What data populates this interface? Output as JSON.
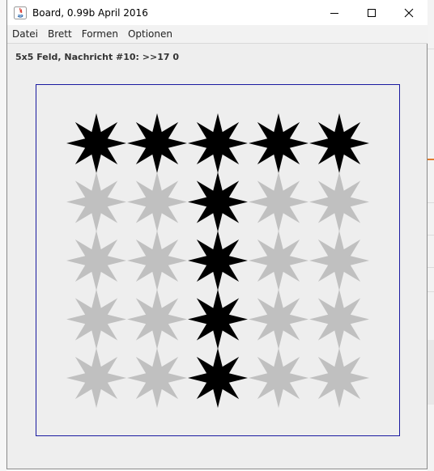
{
  "window": {
    "title": "Board, 0.99b April 2016",
    "controls": [
      "minimize-icon",
      "maximize-icon",
      "close-icon"
    ]
  },
  "menu": {
    "items": [
      "Datei",
      "Brett",
      "Formen",
      "Optionen"
    ]
  },
  "status": {
    "text": "5x5 Feld, Nachricht #10: >>17 0"
  },
  "board": {
    "rows": 5,
    "cols": 5,
    "shape": "star-8-point",
    "colors": {
      "on": "#000000",
      "off": "#c0c0c0",
      "border": "#1a1aa0"
    },
    "cells": [
      [
        1,
        1,
        1,
        1,
        1
      ],
      [
        0,
        0,
        1,
        0,
        0
      ],
      [
        0,
        0,
        1,
        0,
        0
      ],
      [
        0,
        0,
        1,
        0,
        0
      ],
      [
        0,
        0,
        1,
        0,
        0
      ]
    ]
  }
}
